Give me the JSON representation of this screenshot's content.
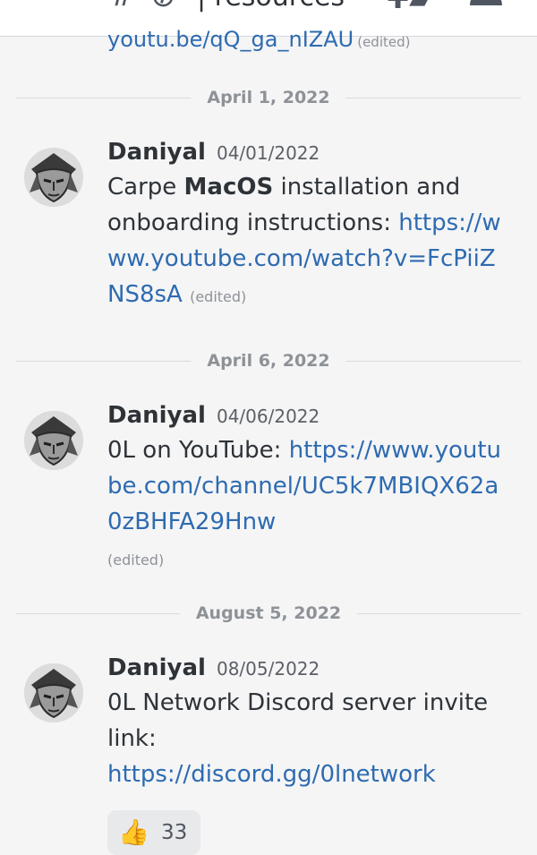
{
  "header": {
    "channel_title": "| resources"
  },
  "previous_message": {
    "link_tail": "youtu.be/qQ_ga_nIZAU",
    "edited": "(edited)"
  },
  "dividers": [
    "April 1, 2022",
    "April 6, 2022",
    "August 5, 2022"
  ],
  "messages": [
    {
      "author": "Daniyal",
      "timestamp": "04/01/2022",
      "text_before": "Carpe ",
      "text_bold": "MacOS",
      "text_after": " installation and onboarding instructions: ",
      "link": "https://www.youtube.com/watch?v=FcPiiZNS8sA",
      "edited": "(edited)"
    },
    {
      "author": "Daniyal",
      "timestamp": "04/06/2022",
      "text": "0L on YouTube: ",
      "link": "https://www.youtube.com/channel/UC5k7MBIQX62a0zBHFA29Hnw",
      "edited": "(edited)"
    },
    {
      "author": "Daniyal",
      "timestamp": "08/05/2022",
      "text": "0L Network Discord server invite link: ",
      "link": "https://discord.gg/0lnetwork",
      "reaction_emoji": "👍",
      "reaction_count": "33"
    }
  ],
  "icons": {
    "menu": "hamburger-icon",
    "channel": "hash-icon",
    "thread": "threads-icon",
    "members": "members-icon",
    "avatar": "avatar-face"
  },
  "colors": {
    "link": "#2e6bb0",
    "background": "#f5f5f6"
  }
}
